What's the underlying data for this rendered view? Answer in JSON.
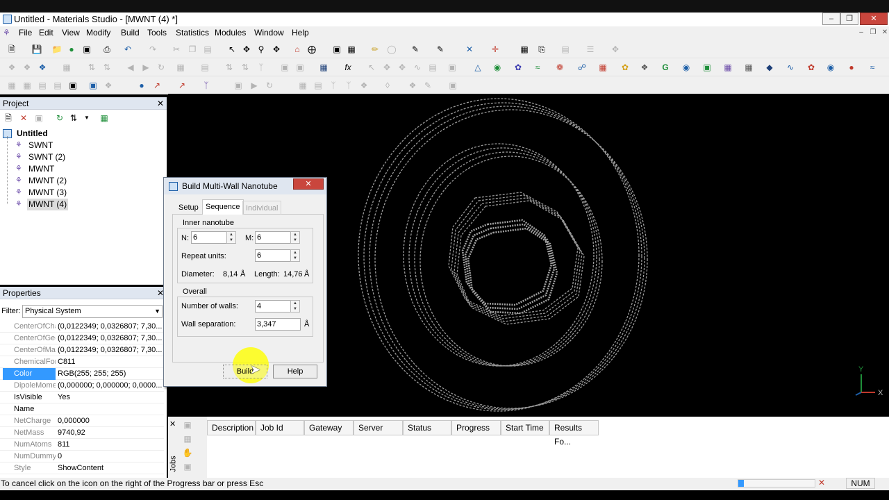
{
  "window": {
    "title": "Untitled - Materials Studio - [MWNT (4) *]"
  },
  "menu": [
    "File",
    "Edit",
    "View",
    "Modify",
    "Build",
    "Tools",
    "Statistics",
    "Modules",
    "Window",
    "Help"
  ],
  "project": {
    "header": "Project",
    "root": "Untitled",
    "items": [
      "SWNT",
      "SWNT (2)",
      "MWNT",
      "MWNT (2)",
      "MWNT (3)",
      "MWNT (4)"
    ]
  },
  "properties": {
    "header": "Properties",
    "filter_label": "Filter:",
    "filter_value": "Physical System",
    "rows": [
      {
        "name": "CenterOfCha",
        "value": "(0,0122349; 0,0326807; 7,30..."
      },
      {
        "name": "CenterOfGeo",
        "value": "(0,0122349; 0,0326807; 7,30..."
      },
      {
        "name": "CenterOfMas",
        "value": "(0,0122349; 0,0326807; 7,30..."
      },
      {
        "name": "ChemicalForr",
        "value": "C811"
      },
      {
        "name": "Color",
        "value": "RGB(255; 255; 255)"
      },
      {
        "name": "DipoleMomer",
        "value": "(0,000000; 0,000000; 0,0000..."
      },
      {
        "name": "IsVisible",
        "value": "Yes"
      },
      {
        "name": "Name",
        "value": ""
      },
      {
        "name": "NetCharge",
        "value": "0,000000"
      },
      {
        "name": "NetMass",
        "value": "9740,92"
      },
      {
        "name": "NumAtoms",
        "value": "811"
      },
      {
        "name": "NumDummy",
        "value": "0"
      },
      {
        "name": "Style",
        "value": "ShowContent"
      }
    ]
  },
  "dialog": {
    "title": "Build Multi-Wall Nanotube",
    "tabs": [
      "Setup",
      "Sequence",
      "Individual"
    ],
    "inner_group": "Inner nanotube",
    "n_label": "N:",
    "n_value": "6",
    "m_label": "M:",
    "m_value": "6",
    "repeat_label": "Repeat units:",
    "repeat_value": "6",
    "diameter_label": "Diameter:",
    "diameter_value": "8,14",
    "diameter_unit": "Å",
    "length_label": "Length:",
    "length_value": "14,76",
    "length_unit": "Å",
    "overall_group": "Overall",
    "walls_label": "Number of walls:",
    "walls_value": "4",
    "sep_label": "Wall separation:",
    "sep_value": "3,347",
    "sep_unit": "Å",
    "build_btn": "Build",
    "help_btn": "Help"
  },
  "axes": {
    "y": "Y",
    "x": "X"
  },
  "jobs": {
    "side_label": "Jobs",
    "columns": [
      "Description",
      "Job Id",
      "Gateway",
      "Server",
      "Status",
      "Progress",
      "Start Time",
      "Results Fo..."
    ]
  },
  "status": {
    "text": "To cancel click on the icon on the right of the Progress bar or press Esc",
    "num": "NUM"
  },
  "colors": {
    "tube": "#9a9a9a",
    "selection": "#3399ff",
    "highlight": "#ffff00"
  }
}
